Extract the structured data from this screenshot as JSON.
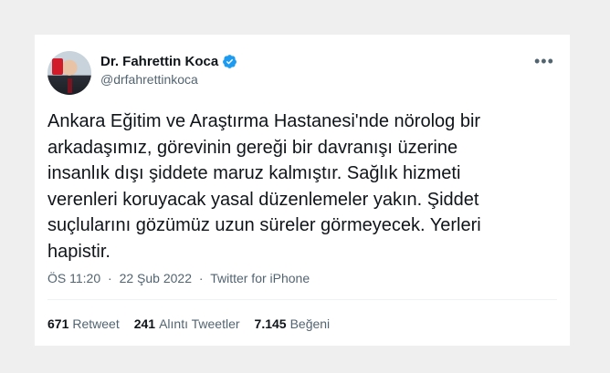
{
  "tweet": {
    "author": {
      "display_name": "Dr. Fahrettin Koca",
      "handle": "@drfahrettinkoca",
      "verified": true
    },
    "text": "Ankara Eğitim ve Araştırma Hastanesi'nde nörolog bir\narkadaşımız, görevinin gereği bir davranışı üzerine\ninsanlık dışı şiddete maruz kalmıştır. Sağlık hizmeti\nverenleri koruyacak yasal düzenlemeler yakın. Şiddet\nsuçlularını gözümüz uzun süreler görmeyecek. Yerleri\nhapistir.",
    "time": "ÖS 11:20",
    "separator": "·",
    "date": "22 Şub 2022",
    "source": "Twitter for iPhone",
    "more_icon": "more-horizontal-icon",
    "stats": [
      {
        "count": "671",
        "label": "Retweet"
      },
      {
        "count": "241",
        "label": "Alıntı Tweetler"
      },
      {
        "count": "7.145",
        "label": "Beğeni"
      }
    ]
  },
  "colors": {
    "verified_badge": "#1d9bf0",
    "secondary_text": "#536471",
    "primary_text": "#0f1419"
  }
}
